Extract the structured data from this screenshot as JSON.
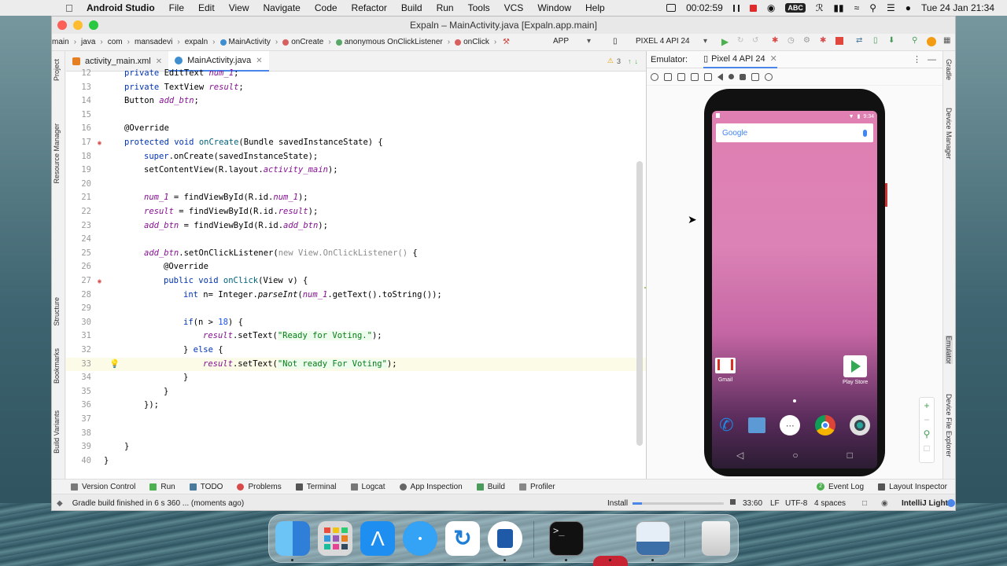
{
  "menubar": {
    "app_name": "Android Studio",
    "items": [
      "File",
      "Edit",
      "View",
      "Navigate",
      "Code",
      "Refactor",
      "Build",
      "Run",
      "Tools",
      "VCS",
      "Window",
      "Help"
    ],
    "recording_time": "00:02:59",
    "input_source": "ABC",
    "datetime": "Tue 24 Jan  21:34"
  },
  "window": {
    "title": "Expaln – MainActivity.java [Expaln.app.main]"
  },
  "breadcrumb": [
    "main",
    "java",
    "com",
    "mansadevi",
    "expaln",
    "MainActivity",
    "onCreate",
    "anonymous OnClickListener",
    "onClick"
  ],
  "toolbar": {
    "run_config": "APP",
    "device": "PIXEL 4 API 24"
  },
  "left_tools": [
    "Project",
    "Resource Manager",
    "Structure",
    "Bookmarks",
    "Build Variants"
  ],
  "right_tools": [
    "Gradle",
    "Device Manager",
    "Emulator",
    "Device File Explorer"
  ],
  "editor_tabs": [
    {
      "label": "activity_main.xml",
      "active": false
    },
    {
      "label": "MainActivity.java",
      "active": true
    }
  ],
  "inspection": {
    "warnings": "3"
  },
  "code_lines": [
    {
      "n": "12",
      "indent": 1,
      "t": "private EditText num_1;"
    },
    {
      "n": "13",
      "indent": 1,
      "t": "private TextView result;"
    },
    {
      "n": "14",
      "indent": 1,
      "t": "Button add_btn;"
    },
    {
      "n": "15",
      "indent": 0,
      "t": ""
    },
    {
      "n": "16",
      "indent": 1,
      "t": "@Override"
    },
    {
      "n": "17",
      "indent": 1,
      "t": "protected void onCreate(Bundle savedInstanceState) {"
    },
    {
      "n": "18",
      "indent": 2,
      "t": "super.onCreate(savedInstanceState);"
    },
    {
      "n": "19",
      "indent": 2,
      "t": "setContentView(R.layout.activity_main);"
    },
    {
      "n": "20",
      "indent": 0,
      "t": ""
    },
    {
      "n": "21",
      "indent": 2,
      "t": "num_1 = findViewById(R.id.num_1);"
    },
    {
      "n": "22",
      "indent": 2,
      "t": "result = findViewById(R.id.result);"
    },
    {
      "n": "23",
      "indent": 2,
      "t": "add_btn = findViewById(R.id.add_btn);"
    },
    {
      "n": "24",
      "indent": 0,
      "t": ""
    },
    {
      "n": "25",
      "indent": 2,
      "t": "add_btn.setOnClickListener(new View.OnClickListener() {"
    },
    {
      "n": "26",
      "indent": 3,
      "t": "@Override"
    },
    {
      "n": "27",
      "indent": 3,
      "t": "public void onClick(View v) {"
    },
    {
      "n": "28",
      "indent": 4,
      "t": "int n= Integer.parseInt(num_1.getText().toString());"
    },
    {
      "n": "29",
      "indent": 0,
      "t": ""
    },
    {
      "n": "30",
      "indent": 4,
      "t": "if(n > 18) {"
    },
    {
      "n": "31",
      "indent": 5,
      "t": "result.setText(\"Ready for Voting.\");"
    },
    {
      "n": "32",
      "indent": 4,
      "t": "} else {"
    },
    {
      "n": "33",
      "indent": 5,
      "t": "result.setText(\"Not ready For Voting\");"
    },
    {
      "n": "34",
      "indent": 4,
      "t": "}"
    },
    {
      "n": "35",
      "indent": 3,
      "t": "}"
    },
    {
      "n": "36",
      "indent": 2,
      "t": "});"
    },
    {
      "n": "37",
      "indent": 0,
      "t": ""
    },
    {
      "n": "38",
      "indent": 0,
      "t": ""
    },
    {
      "n": "39",
      "indent": 1,
      "t": "}"
    },
    {
      "n": "40",
      "indent": 0,
      "t": "}"
    }
  ],
  "emulator": {
    "panel_label": "Emulator:",
    "device_tab": "Pixel 4 API 24",
    "status_time": "9:34",
    "search_logo": "Google",
    "apps": {
      "gmail": "Gmail",
      "playstore": "Play Store"
    }
  },
  "bottom_tools": [
    "Version Control",
    "Run",
    "TODO",
    "Problems",
    "Terminal",
    "Logcat",
    "App Inspection",
    "Build",
    "Profiler"
  ],
  "bottom_right_tools": {
    "event_log": "Event Log",
    "event_count": "2",
    "layout_inspector": "Layout Inspector"
  },
  "status": {
    "message": "Gradle build finished in 6 s 360 ... (moments ago)",
    "install_label": "Install",
    "cursor": "33:60",
    "line_sep": "LF",
    "encoding": "UTF-8",
    "indent": "4 spaces",
    "theme": "IntelliJ Light"
  }
}
